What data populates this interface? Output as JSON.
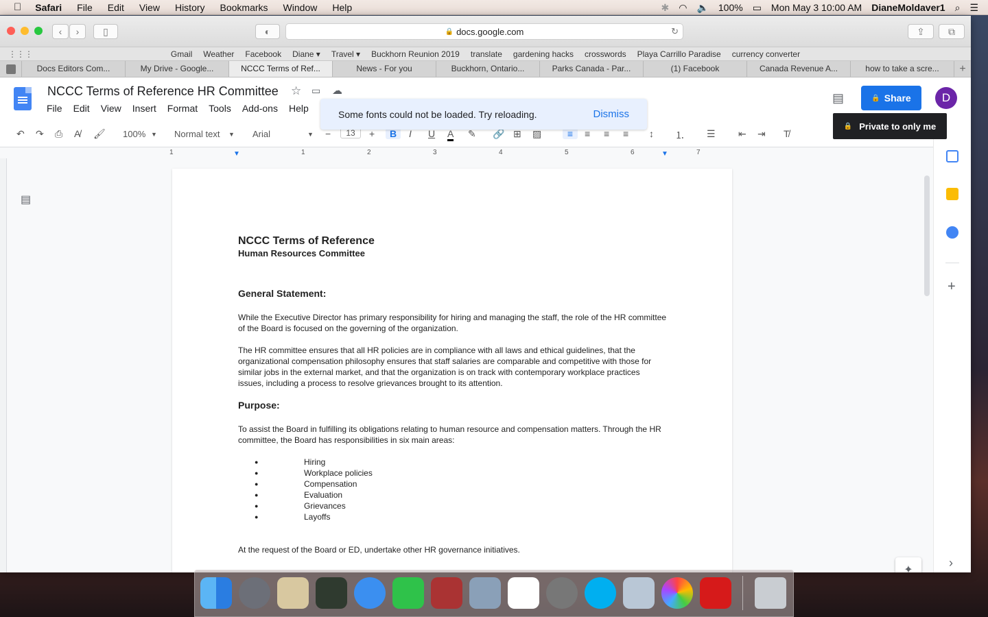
{
  "menubar": {
    "app": "Safari",
    "items": [
      "File",
      "Edit",
      "View",
      "History",
      "Bookmarks",
      "Window",
      "Help"
    ],
    "battery": "100%",
    "datetime": "Mon May 3  10:00 AM",
    "user": "DianeMoldaver1"
  },
  "browser": {
    "url": "docs.google.com",
    "bookmarks": [
      "Gmail",
      "Weather",
      "Facebook",
      "Diane ▾",
      "Travel ▾",
      "Buckhorn Reunion 2019",
      "translate",
      "gardening hacks",
      "crosswords",
      "Playa Carrillo Paradise",
      "currency converter"
    ],
    "tabs": [
      "Docs Editors Com...",
      "My Drive - Google...",
      "NCCC Terms of Ref...",
      "News - For you",
      "Buckhorn, Ontario...",
      "Parks Canada - Par...",
      "(1) Facebook",
      "Canada Revenue A...",
      "how to take a scre..."
    ]
  },
  "docs": {
    "title": "NCCC Terms of Reference HR Committee",
    "menu": [
      "File",
      "Edit",
      "View",
      "Insert",
      "Format",
      "Tools",
      "Add-ons",
      "Help"
    ],
    "share_label": "Share",
    "avatar_letter": "D",
    "tooltip": "Private to only me",
    "toast_message": "Some fonts could not be loaded. Try reloading.",
    "toast_action": "Dismiss",
    "toolbar": {
      "zoom": "100%",
      "style": "Normal text",
      "font": "Arial",
      "size": "13"
    },
    "ruler": [
      "1",
      "1",
      "2",
      "3",
      "4",
      "5",
      "6",
      "7"
    ]
  },
  "document": {
    "title": "NCCC Terms of Reference",
    "subtitle": "Human Resources Committee",
    "general_heading": "General Statement:",
    "general_p1": "While the Executive Director has primary responsibility for hiring and managing the staff, the role of the HR committee of the Board is focused on the governing of the organization.",
    "general_p2": "The HR committee ensures that all HR policies are in compliance with all laws and ethical guidelines, that the organizational compensation philosophy ensures that staff salaries are comparable and competitive with those for similar jobs in the external market, and that the organization is on track with contemporary workplace practices issues, including a process to resolve grievances brought to its attention.",
    "purpose_heading": "Purpose:",
    "purpose_p": "To assist the Board in fulfilling its obligations relating to human resource and compensation matters.  Through the HR committee, the Board has responsibilities in six main areas:",
    "areas": [
      "Hiring",
      "Workplace policies",
      "Compensation",
      "Evaluation",
      "Grievances",
      "Layoffs"
    ],
    "closing": "At the request of the Board or ED, undertake other HR governance initiatives."
  },
  "colors": {
    "accent": "#1a73e8",
    "avatar": "#6b25a8",
    "toast_bg": "#e8f0fe"
  }
}
